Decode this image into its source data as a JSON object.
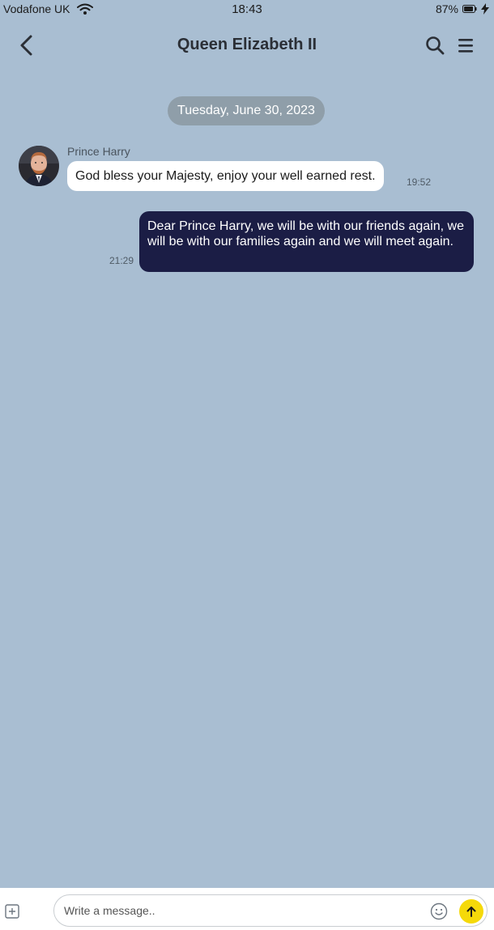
{
  "status_bar": {
    "carrier": "Vodafone UK",
    "time": "18:43",
    "battery": "87%"
  },
  "header": {
    "title": "Queen Elizabeth II",
    "icons": [
      "chevron-left-icon",
      "search-icon",
      "menu-icon"
    ]
  },
  "chat": {
    "date_separator": "Tuesday, June 30, 2023",
    "messages": [
      {
        "direction": "incoming",
        "sender": "Prince Harry",
        "text": "God bless your Majesty, enjoy your well earned rest.",
        "time": "19:52"
      },
      {
        "direction": "outgoing",
        "text": "Dear Prince Harry, we will be with our friends again, we will be with our families again and we will meet again.",
        "time": "21:29"
      }
    ]
  },
  "composer": {
    "placeholder": "Write a message..",
    "value": "",
    "icons": [
      "attach-icon",
      "emoji-icon",
      "send-arrow-icon"
    ],
    "send_color": "#f5d90a"
  },
  "colors": {
    "background": "#a9bed2",
    "outgoing_bubble": "#1b1d45",
    "incoming_bubble": "#ffffff",
    "date_pill": "#8f9ea9"
  }
}
